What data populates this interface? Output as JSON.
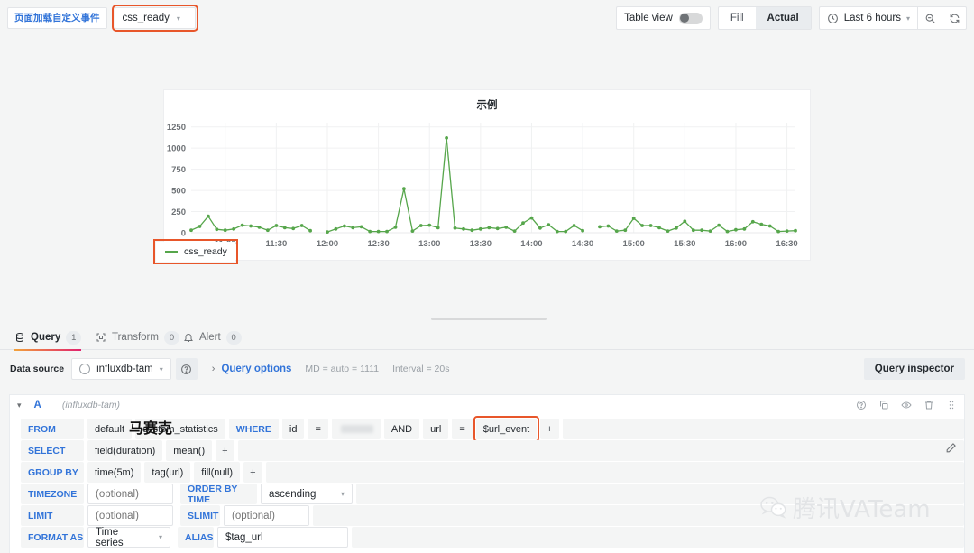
{
  "topbar": {
    "event_label": "页面加载自定义事件",
    "event_value": "css_ready",
    "table_view_label": "Table view",
    "fill_label": "Fill",
    "actual_label": "Actual",
    "time_range": "Last 6 hours",
    "zoom_out_icon": "zoom-out-icon",
    "refresh_icon": "refresh-icon",
    "clock_icon": "clock-icon"
  },
  "panel": {
    "title": "示例",
    "legend_series": "css_ready"
  },
  "chart_data": {
    "type": "line",
    "title": "示例",
    "xlabel": "",
    "ylabel": "",
    "ylim": [
      0,
      1300
    ],
    "yticks": [
      0,
      250,
      500,
      750,
      1000,
      1250
    ],
    "xticks": [
      "11:00",
      "11:30",
      "12:00",
      "12:30",
      "13:00",
      "13:30",
      "14:00",
      "14:30",
      "15:00",
      "15:30",
      "16:00",
      "16:30"
    ],
    "grid": true,
    "legend_position": "bottom-left",
    "series": [
      {
        "name": "css_ready",
        "color": "#56a64b",
        "x": [
          "10:40",
          "10:45",
          "10:50",
          "10:55",
          "11:00",
          "11:05",
          "11:10",
          "11:15",
          "11:20",
          "11:25",
          "11:30",
          "11:35",
          "11:40",
          "11:45",
          "11:50",
          "11:55",
          "12:00",
          "12:05",
          "12:10",
          "12:15",
          "12:20",
          "12:25",
          "12:30",
          "12:35",
          "12:40",
          "12:45",
          "12:50",
          "12:55",
          "13:00",
          "13:05",
          "13:10",
          "13:15",
          "13:20",
          "13:25",
          "13:30",
          "13:35",
          "13:40",
          "13:45",
          "13:50",
          "13:55",
          "14:00",
          "14:05",
          "14:10",
          "14:15",
          "14:20",
          "14:25",
          "14:30",
          "14:35",
          "14:40",
          "14:45",
          "14:50",
          "14:55",
          "15:00",
          "15:05",
          "15:10",
          "15:15",
          "15:20",
          "15:25",
          "15:30",
          "15:35",
          "15:40",
          "15:45",
          "15:50",
          "15:55",
          "16:00",
          "16:05",
          "16:10",
          "16:15",
          "16:20",
          "16:25",
          "16:30",
          "16:35"
        ],
        "values": [
          30,
          75,
          195,
          40,
          30,
          45,
          90,
          80,
          65,
          30,
          85,
          60,
          50,
          85,
          25,
          null,
          10,
          45,
          80,
          60,
          70,
          15,
          15,
          15,
          65,
          520,
          20,
          85,
          90,
          60,
          1120,
          55,
          45,
          30,
          45,
          60,
          50,
          65,
          20,
          115,
          175,
          55,
          95,
          15,
          15,
          85,
          25,
          null,
          70,
          80,
          20,
          30,
          170,
          85,
          85,
          60,
          20,
          55,
          135,
          30,
          30,
          20,
          90,
          15,
          35,
          45,
          130,
          100,
          80,
          15,
          20,
          25
        ]
      }
    ]
  },
  "tabs": [
    {
      "label": "Query",
      "count": "1",
      "icon": "database-icon",
      "active": true
    },
    {
      "label": "Transform",
      "count": "0",
      "icon": "transform-icon",
      "active": false
    },
    {
      "label": "Alert",
      "count": "0",
      "icon": "bell-icon",
      "active": false
    }
  ],
  "datasource_row": {
    "label": "Data source",
    "value": "influxdb-tam",
    "help_icon": "help-circle-icon",
    "query_options_label": "Query options",
    "md_text": "MD = auto = 1111",
    "interval_text": "Interval = 20s",
    "query_inspector_label": "Query inspector"
  },
  "query": {
    "id": "A",
    "datasource": "(influxdb-tam)",
    "icons": [
      "help-circle-icon",
      "copy-icon",
      "eye-icon",
      "trash-icon",
      "drag-handle-icon"
    ],
    "edit_icon": "pencil-icon",
    "rows": {
      "from": {
        "label": "FROM",
        "policy": "default",
        "measurement": "custom_statistics",
        "where_label": "WHERE",
        "cond1_field": "id",
        "cond1_op": "=",
        "cond1_value": "",
        "and_label": "AND",
        "cond2_field": "url",
        "cond2_op": "=",
        "cond2_value": "$url_event",
        "plus": "+"
      },
      "select": {
        "label": "SELECT",
        "field": "field(duration)",
        "agg": "mean()",
        "plus": "+"
      },
      "group_by": {
        "label": "GROUP BY",
        "time": "time(5m)",
        "tag": "tag(url)",
        "fill": "fill(null)",
        "plus": "+"
      },
      "timezone": {
        "label": "TIMEZONE",
        "placeholder": "(optional)",
        "value": ""
      },
      "order_by": {
        "label": "ORDER BY TIME",
        "value": "ascending"
      },
      "limit": {
        "label": "LIMIT",
        "placeholder": "(optional)",
        "value": ""
      },
      "slimit": {
        "label": "SLIMIT",
        "placeholder": "(optional)",
        "value": ""
      },
      "format_as": {
        "label": "FORMAT AS",
        "value": "Time series"
      },
      "alias": {
        "label": "ALIAS",
        "value": "$tag_url"
      }
    }
  },
  "overlays": {
    "mosaic_text": "马赛克",
    "watermark_text": "腾讯VATeam"
  }
}
